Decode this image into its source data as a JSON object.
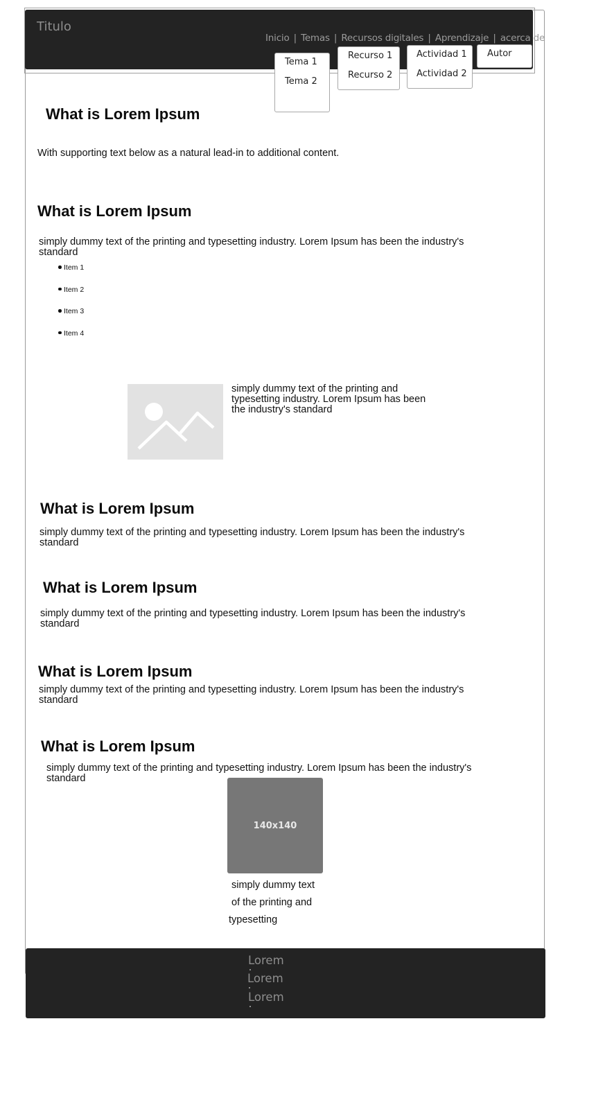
{
  "header": {
    "title": "Titulo",
    "nav": [
      "Inicio",
      "Temas",
      "Recursos digitales",
      "Aprendizaje",
      "acerca de"
    ],
    "separator": "|"
  },
  "dropdowns": {
    "temas": [
      "Tema 1",
      "Tema 2"
    ],
    "recursos": [
      "Recurso 1",
      "Recurso 2"
    ],
    "actividades": [
      "Actividad 1",
      "Actividad 2"
    ],
    "acerca": [
      "Autor"
    ]
  },
  "sections": [
    {
      "heading": "What is Lorem Ipsum",
      "text": "With supporting text below as a natural lead-in to additional content."
    },
    {
      "heading": "What is Lorem Ipsum",
      "text": "simply dummy text of the printing and typesetting industry. Lorem Ipsum has been the industry's standard"
    },
    {
      "heading": "What is Lorem Ipsum",
      "text": "simply dummy text of the printing and typesetting industry. Lorem Ipsum has been the industry's standard"
    },
    {
      "heading": "What is Lorem Ipsum",
      "text": "simply dummy text of the printing and typesetting industry. Lorem Ipsum has been the industry's standard"
    },
    {
      "heading": "What is Lorem Ipsum",
      "text": "simply dummy text of the printing and typesetting industry. Lorem Ipsum has been the industry's standard"
    },
    {
      "heading": "What is Lorem Ipsum",
      "text": "simply dummy text of the printing and typesetting industry. Lorem Ipsum has been the industry's standard"
    }
  ],
  "list_items": [
    "Item 1",
    "Item 2",
    "Item 3",
    "Item 4"
  ],
  "media": {
    "icon": "image-placeholder-icon",
    "text": "simply dummy text of the printing and typesetting industry. Lorem Ipsum has been the industry's   standard"
  },
  "thumbnail": {
    "label": "140x140",
    "caption": [
      "simply dummy text",
      "of the printing and",
      "typesetting"
    ]
  },
  "footer": {
    "items": [
      "Lorem",
      "Lorem",
      "Lorem"
    ]
  },
  "colors": {
    "header_bg": "#232323",
    "footer_bg": "#232323",
    "header_text": "#8e8e8e",
    "thumbnail_bg": "#777777",
    "placeholder_bg": "#e2e2e2"
  }
}
